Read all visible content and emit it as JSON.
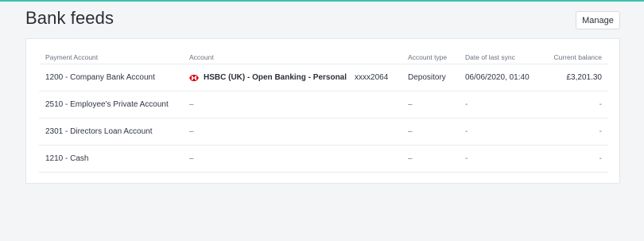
{
  "page": {
    "title": "Bank feeds"
  },
  "toolbar": {
    "manage_label": "Manage"
  },
  "table": {
    "headers": {
      "payment_account": "Payment Account",
      "account": "Account",
      "account_type": "Account type",
      "last_sync": "Date of last sync",
      "balance": "Current balance"
    },
    "rows": [
      {
        "payment_account": "1200 - Company Bank Account",
        "account_name": "HSBC (UK) - Open Banking - Personal",
        "account_mask": "xxxx2064",
        "account_type": "Depository",
        "last_sync": "06/06/2020, 01:40",
        "balance": "£3,201.30"
      },
      {
        "payment_account": "2510 - Employee's Private Account",
        "account": "–",
        "account_type": "–",
        "last_sync": "-",
        "balance": "-"
      },
      {
        "payment_account": "2301 - Directors Loan Account",
        "account": "–",
        "account_type": "–",
        "last_sync": "-",
        "balance": "-"
      },
      {
        "payment_account": "1210 - Cash",
        "account": "–",
        "account_type": "–",
        "last_sync": "-",
        "balance": "-"
      }
    ]
  },
  "icons": {
    "bank_logo": "hsbc-logo-icon"
  },
  "colors": {
    "accent": "#3cc4b0",
    "hsbc_red": "#db0011"
  }
}
